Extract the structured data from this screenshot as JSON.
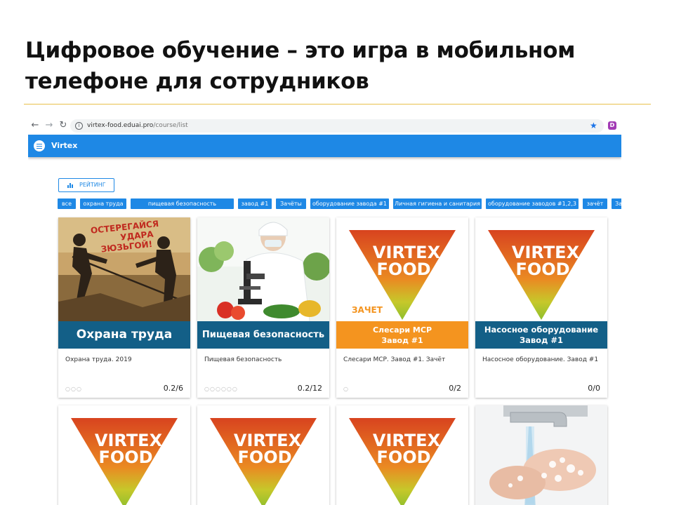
{
  "slide": {
    "title_line1": "Цифровое обучение – это игра в мобильном",
    "title_line2": "телефоне для сотрудников"
  },
  "browser": {
    "back_icon": "arrow-left-icon",
    "forward_icon": "arrow-right-icon",
    "reload_icon": "reload-icon",
    "url_host": "virtex-food.eduai.pro",
    "url_path": "/course/list",
    "ext_letter": "D"
  },
  "app": {
    "title": "Virtex",
    "accent": "#1e88e5",
    "rating_label": "РЕЙТИНГ"
  },
  "filters": [
    "все",
    "охрана труда",
    "пищевая безопасность",
    "завод #1",
    "Зачёты",
    "оборудование завода #1",
    "Личная гигиена и санитария",
    "оборудование заводов #1,2,3",
    "зачёт",
    "Зачёты"
  ],
  "logo": {
    "word1": "VIRTEX",
    "word2": "FOOD",
    "reg": "®"
  },
  "cards": [
    {
      "poster_line1": "ОСТЕРЕГАЙСЯ",
      "poster_line2": "УДАРА",
      "poster_line3": "ЗЮЗЬГОЙ!",
      "banner": "Охрана труда",
      "description": "Охрана труда. 2019",
      "progress_dots": "○○○",
      "score": "0.2/6"
    },
    {
      "banner": "Пищевая безопасность",
      "description": "Пищевая безопасность",
      "progress_dots": "○○○○○○",
      "score": "0.2/12"
    },
    {
      "badge": "ЗАЧЕТ",
      "banner_line1": "Слесари МСР",
      "banner_line2": "Завод #1",
      "description": "Слесари МСР. Завод #1. Зачёт",
      "progress_dots": "○",
      "score": "0/2"
    },
    {
      "banner_line1": "Насосное оборудование",
      "banner_line2": "Завод #1",
      "description": "Насосное оборудование. Завод #1",
      "score": "0/0"
    }
  ]
}
